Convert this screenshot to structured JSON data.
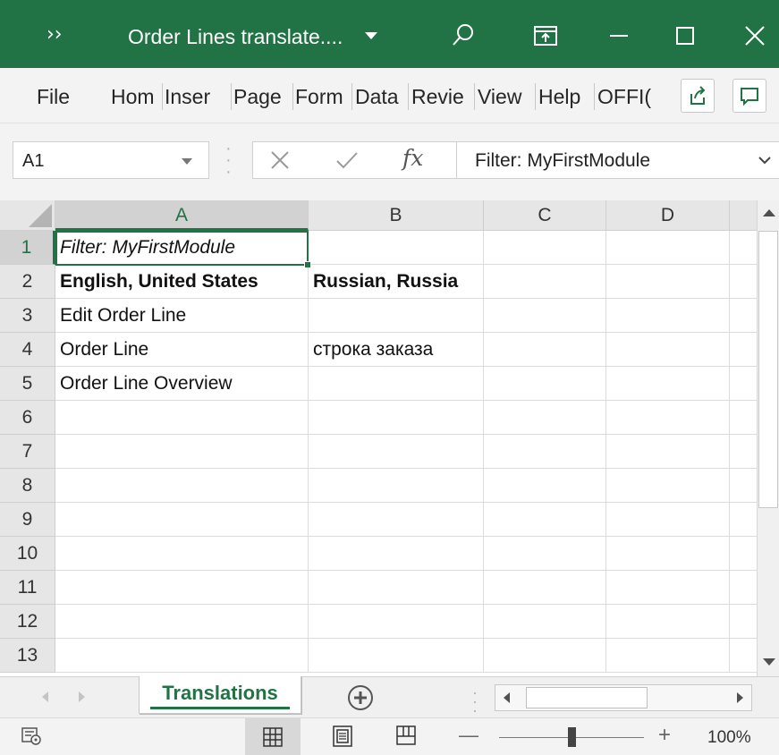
{
  "window": {
    "title": "Order Lines translate....",
    "accent": "#217346"
  },
  "ribbon": {
    "tabs": [
      {
        "label": "File"
      },
      {
        "label": "Hom"
      },
      {
        "label": "Inser"
      },
      {
        "label": "Page"
      },
      {
        "label": "Form"
      },
      {
        "label": "Data"
      },
      {
        "label": "Revie"
      },
      {
        "label": "View"
      },
      {
        "label": "Help"
      },
      {
        "label": "OFFI("
      }
    ],
    "share_icon": "share-icon",
    "comment_icon": "comment-icon"
  },
  "formula_bar": {
    "name_box": "A1",
    "fx_label": "fx",
    "content": "Filter: MyFirstModule"
  },
  "sheet": {
    "columns": [
      "A",
      "B",
      "C",
      "D"
    ],
    "rows": [
      {
        "num": "1",
        "a": "Filter: MyFirstModule",
        "b": "",
        "c": "",
        "d": ""
      },
      {
        "num": "2",
        "a": "English, United States",
        "b": "Russian, Russia",
        "c": "",
        "d": ""
      },
      {
        "num": "3",
        "a": "Edit Order Line",
        "b": "",
        "c": "",
        "d": ""
      },
      {
        "num": "4",
        "a": "Order Line",
        "b": "строка заказа",
        "c": "",
        "d": ""
      },
      {
        "num": "5",
        "a": "Order Line Overview",
        "b": "",
        "c": "",
        "d": ""
      },
      {
        "num": "6",
        "a": "",
        "b": "",
        "c": "",
        "d": ""
      },
      {
        "num": "7",
        "a": "",
        "b": "",
        "c": "",
        "d": ""
      },
      {
        "num": "8",
        "a": "",
        "b": "",
        "c": "",
        "d": ""
      },
      {
        "num": "9",
        "a": "",
        "b": "",
        "c": "",
        "d": ""
      },
      {
        "num": "10",
        "a": "",
        "b": "",
        "c": "",
        "d": ""
      },
      {
        "num": "11",
        "a": "",
        "b": "",
        "c": "",
        "d": ""
      },
      {
        "num": "12",
        "a": "",
        "b": "",
        "c": "",
        "d": ""
      },
      {
        "num": "13",
        "a": "",
        "b": "",
        "c": "",
        "d": ""
      }
    ]
  },
  "sheet_tabs": {
    "active": "Translations"
  },
  "status": {
    "zoom": "100%",
    "zoom_fraction": 0.5
  }
}
